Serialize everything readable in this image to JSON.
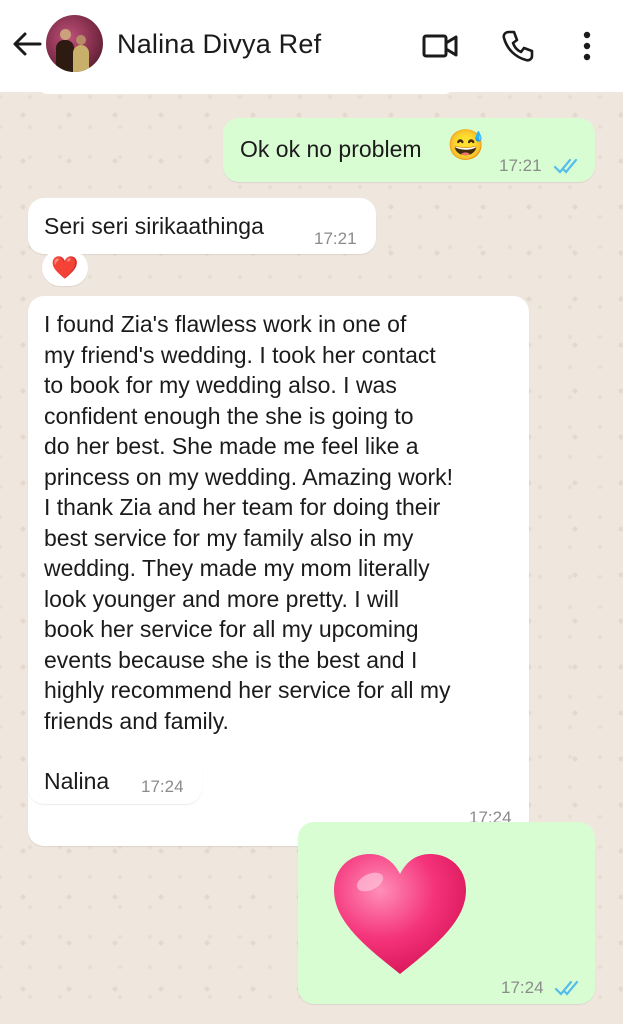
{
  "header": {
    "contact_name": "Nalina Divya Ref",
    "icons": [
      "back-arrow-icon",
      "contact-avatar",
      "video-call-icon",
      "voice-call-icon",
      "more-options-icon"
    ]
  },
  "messages": [
    {
      "direction": "outgoing",
      "text": "Ok ok no problem",
      "emoji": "😅",
      "time": "17:21",
      "status": "read"
    },
    {
      "direction": "incoming",
      "text": "Seri seri sirikaathinga",
      "time": "17:21",
      "reaction": "❤️"
    },
    {
      "direction": "incoming",
      "lines": [
        "I found Zia's flawless work in one of",
        "my friend's wedding. I took her contact",
        "to book for my wedding also. I was",
        "confident enough the she is going to",
        "do her best. She made me feel like a",
        "princess on my wedding. Amazing work!",
        "I thank Zia and her team for doing their",
        "best service for my family also in my",
        "wedding. They made my mom literally",
        "look younger and more pretty. I will",
        "book her service for all my upcoming",
        "events because she is the best and I",
        "highly recommend her service for all my",
        "friends and family."
      ],
      "time": "17:24"
    },
    {
      "direction": "incoming",
      "text": "Nalina",
      "time": "17:24"
    },
    {
      "direction": "outgoing",
      "emoji": "heart-emoji",
      "time": "17:24",
      "status": "read"
    }
  ],
  "colors": {
    "outgoing_bubble": "#d9fdd3",
    "incoming_bubble": "#ffffff",
    "read_ticks": "#53bdeb",
    "wallpaper": "#efe7de"
  }
}
